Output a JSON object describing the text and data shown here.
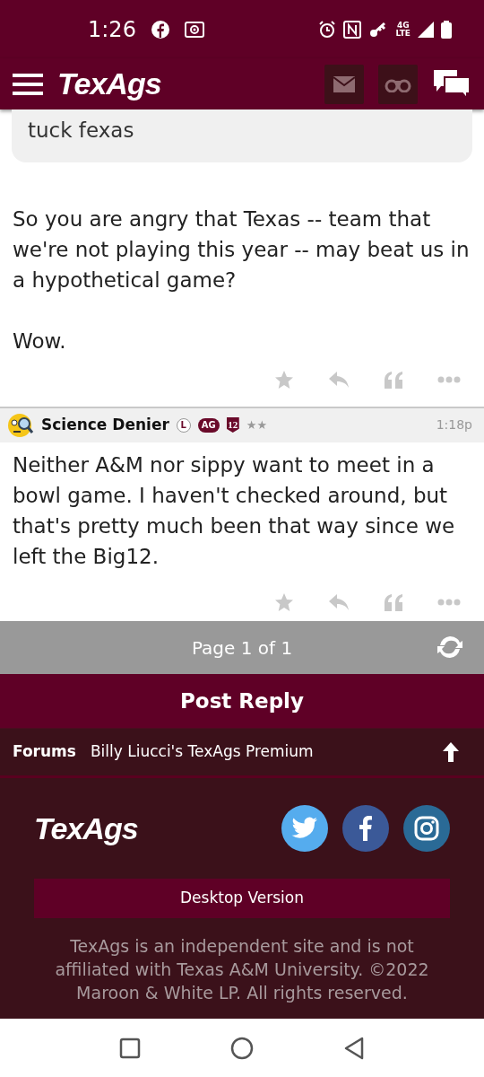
{
  "status_bar": {
    "time": "1:26",
    "network": "4G",
    "network_sub": "LTE"
  },
  "header": {
    "logo": "TexAgs"
  },
  "posts": [
    {
      "quote": "tuck fexas",
      "paragraphs": [
        "So you are angry that Texas -- team that we're not playing this year -- may beat us in a hypothetical game?",
        "Wow."
      ]
    },
    {
      "author": "Science Denier",
      "badges": [
        {
          "kind": "circle",
          "text": "L"
        },
        {
          "kind": "pill",
          "text": "AG"
        },
        {
          "kind": "shield",
          "text": "12"
        }
      ],
      "rank_stars": "★★",
      "time": "1:18p",
      "paragraphs": [
        "Neither A&M nor sippy want to meet in a bowl game. I haven't checked around, but that's pretty much been that way since we left the Big12."
      ]
    }
  ],
  "pager": {
    "label": "Page 1 of 1"
  },
  "post_reply": "Post Reply",
  "breadcrumb": {
    "root": "Forums",
    "current": "Billy Liucci's TexAgs Premium"
  },
  "footer": {
    "logo": "TexAgs",
    "desktop_button": "Desktop Version",
    "disclaimer": "TexAgs is an independent site and is not affiliated with Texas A&M University. ©2022 Maroon & White LP. All rights reserved."
  }
}
